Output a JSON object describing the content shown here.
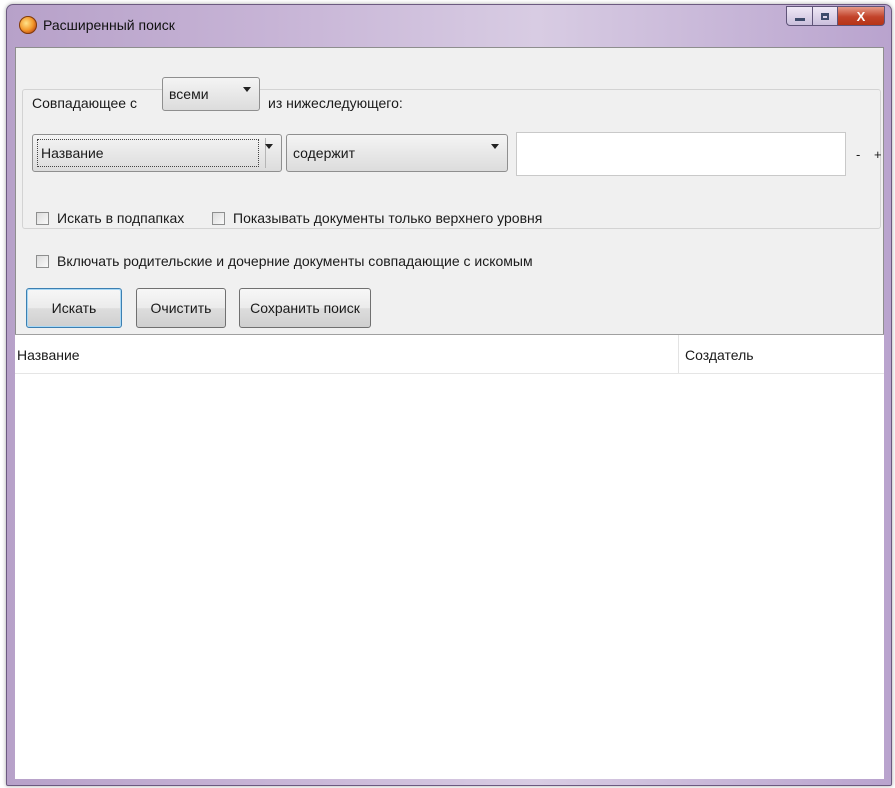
{
  "window": {
    "title": "Расширенный поиск",
    "controls": {
      "minimize": "minimize",
      "maximize": "maximize",
      "close": "X"
    }
  },
  "criteria": {
    "match_prefix": "Совпадающее с",
    "match_mode": "всеми",
    "match_suffix": "из нижеследующего:",
    "field": "Название",
    "condition": "содержит",
    "value": "",
    "remove_label": "-",
    "add_label": "+"
  },
  "options": {
    "search_subfolders": {
      "label": "Искать в подпапках",
      "checked": false
    },
    "top_level_only": {
      "label": "Показывать документы только верхнего уровня",
      "checked": false
    },
    "include_parents": {
      "label": "Включать родительские и дочерние документы совпадающие с искомым",
      "checked": false
    }
  },
  "buttons": {
    "search": "Искать",
    "clear": "Очистить",
    "save": "Сохранить поиск"
  },
  "results": {
    "columns": [
      "Название",
      "Создатель"
    ],
    "rows": []
  }
}
